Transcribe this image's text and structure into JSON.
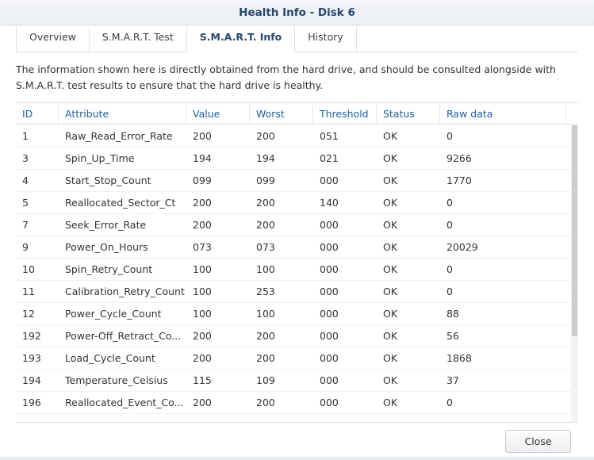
{
  "window": {
    "title": "Health Info - Disk 6"
  },
  "tabs": [
    {
      "label": "Overview",
      "active": false
    },
    {
      "label": "S.M.A.R.T. Test",
      "active": false
    },
    {
      "label": "S.M.A.R.T. Info",
      "active": true
    },
    {
      "label": "History",
      "active": false
    }
  ],
  "description": "The information shown here is directly obtained from the hard drive, and should be consulted alongside with S.M.A.R.T. test results to ensure that the hard drive is healthy.",
  "table": {
    "columns": [
      "ID",
      "Attribute",
      "Value",
      "Worst",
      "Threshold",
      "Status",
      "Raw data"
    ],
    "rows": [
      [
        "1",
        "Raw_Read_Error_Rate",
        "200",
        "200",
        "051",
        "OK",
        "0"
      ],
      [
        "3",
        "Spin_Up_Time",
        "194",
        "194",
        "021",
        "OK",
        "9266"
      ],
      [
        "4",
        "Start_Stop_Count",
        "099",
        "099",
        "000",
        "OK",
        "1770"
      ],
      [
        "5",
        "Reallocated_Sector_Ct",
        "200",
        "200",
        "140",
        "OK",
        "0"
      ],
      [
        "7",
        "Seek_Error_Rate",
        "200",
        "200",
        "000",
        "OK",
        "0"
      ],
      [
        "9",
        "Power_On_Hours",
        "073",
        "073",
        "000",
        "OK",
        "20029"
      ],
      [
        "10",
        "Spin_Retry_Count",
        "100",
        "100",
        "000",
        "OK",
        "0"
      ],
      [
        "11",
        "Calibration_Retry_Count",
        "100",
        "253",
        "000",
        "OK",
        "0"
      ],
      [
        "12",
        "Power_Cycle_Count",
        "100",
        "100",
        "000",
        "OK",
        "88"
      ],
      [
        "192",
        "Power-Off_Retract_Co...",
        "200",
        "200",
        "000",
        "OK",
        "56"
      ],
      [
        "193",
        "Load_Cycle_Count",
        "200",
        "200",
        "000",
        "OK",
        "1868"
      ],
      [
        "194",
        "Temperature_Celsius",
        "115",
        "109",
        "000",
        "OK",
        "37"
      ],
      [
        "196",
        "Reallocated_Event_Co...",
        "200",
        "200",
        "000",
        "OK",
        "0"
      ]
    ]
  },
  "footer": {
    "close_label": "Close"
  },
  "colors": {
    "title": "#27476d",
    "header_text": "#1f5ea8",
    "border": "#dde2e8"
  }
}
